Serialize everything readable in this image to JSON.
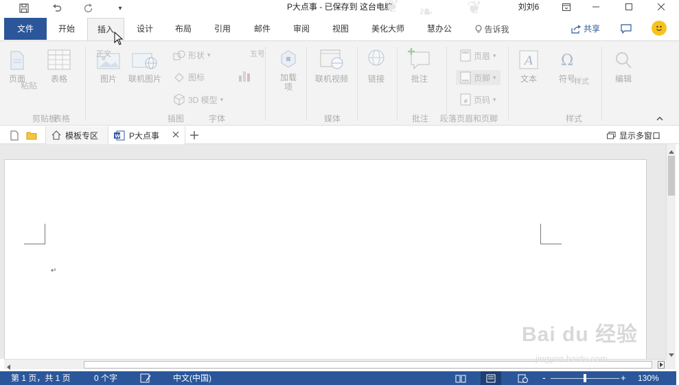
{
  "window": {
    "title": "P大点事 - 已保存到 这台电脑",
    "user": "刘刘6"
  },
  "menu_tabs": [
    {
      "label": "文件"
    },
    {
      "label": "开始"
    },
    {
      "label": "插入"
    },
    {
      "label": "设计"
    },
    {
      "label": "布局"
    },
    {
      "label": "引用"
    },
    {
      "label": "邮件"
    },
    {
      "label": "审阅"
    },
    {
      "label": "视图"
    },
    {
      "label": "美化大师"
    },
    {
      "label": "慧办公"
    }
  ],
  "active_tab": "插入",
  "tell_me": "告诉我",
  "share": "共享",
  "ribbon": {
    "buttons": {
      "page": "页面",
      "table": "表格",
      "picture": "图片",
      "online_picture": "联机图片",
      "addin": "加载",
      "addin_sub": "项",
      "online_video": "联机视频",
      "link": "链接",
      "comment": "批注",
      "text": "文本",
      "symbol": "符号",
      "edit": "编辑"
    },
    "small": {
      "shape": "形状",
      "icon": "图标",
      "model3d": "3D 模型",
      "header": "页眉",
      "footer": "页脚",
      "page_number": "页码",
      "ghost_paste": "粘贴",
      "ghost_font_size": "五号",
      "ghost_style": "样式",
      "ghost_symbol": "正文"
    },
    "groups": {
      "clipboard": "剪贴板",
      "tables": "表格",
      "illustrations": "插图",
      "font": "字体",
      "media": "媒体",
      "comments": "批注",
      "paragraph": "段落",
      "header_footer": "页眉和页脚",
      "styles": "样式"
    }
  },
  "doc_tabs": {
    "template": "模板专区",
    "document": "P大点事",
    "multi_window": "显示多窗口"
  },
  "status": {
    "page": "第 1 页，共 1 页",
    "words": "0 个字",
    "language": "中文(中国)",
    "zoom": "130%",
    "zoom_level": 0.5
  },
  "watermark": {
    "brand": "Bai du 经验",
    "url": "jingyan.baidu.com"
  },
  "colors": {
    "accent": "#2b579a",
    "ribbon_bg": "#f3f3f3"
  }
}
